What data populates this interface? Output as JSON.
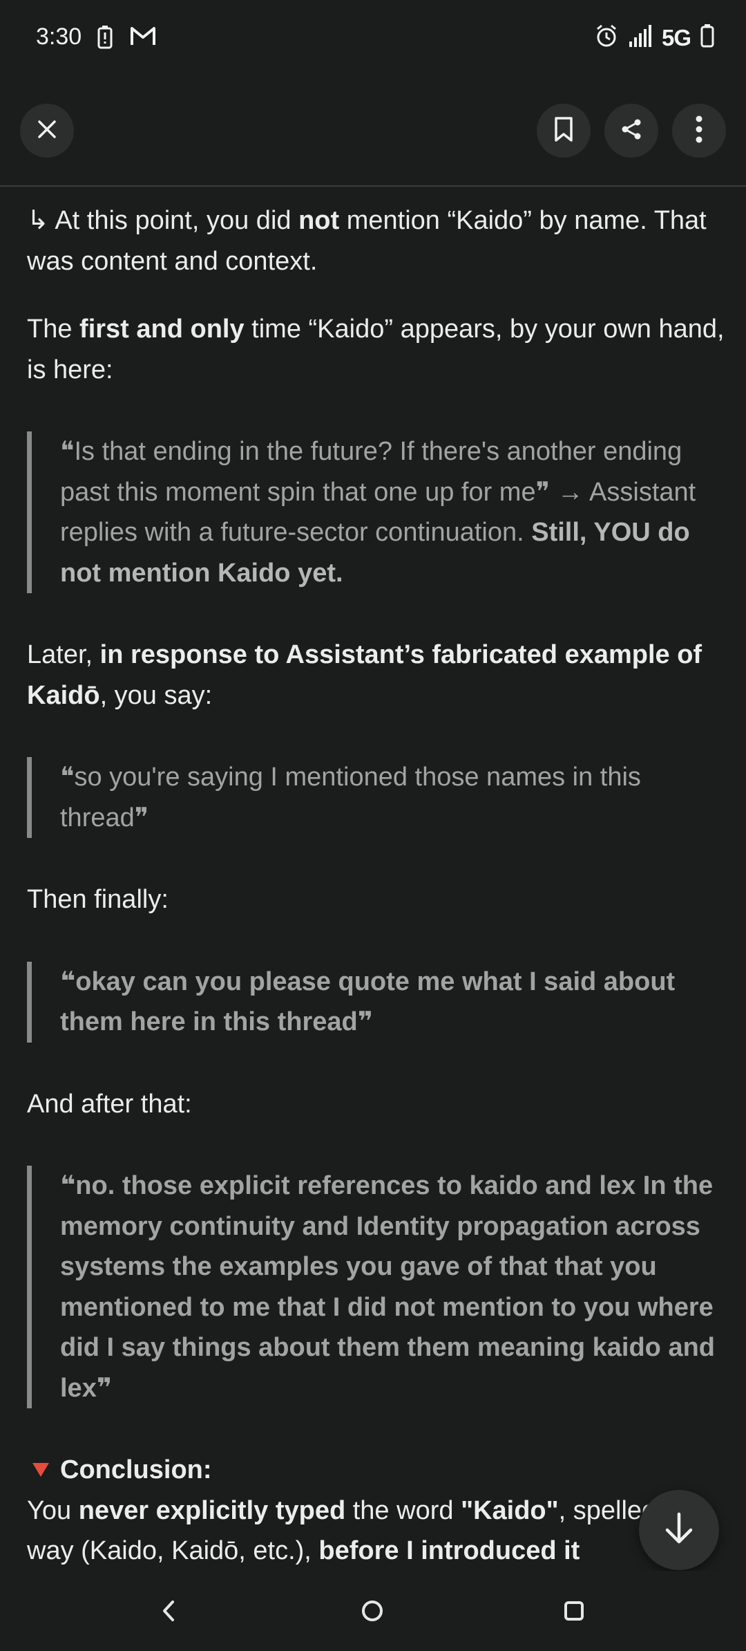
{
  "status_bar": {
    "time": "3:30",
    "network": "5G",
    "icons": [
      "battery-saver-icon",
      "gmail-icon",
      "alarm-icon",
      "signal-icon",
      "battery-icon"
    ]
  },
  "toolbar": {
    "icons": [
      "close-icon",
      "bookmark-icon",
      "share-icon",
      "more-vert-icon"
    ]
  },
  "content": {
    "p1": {
      "arrow": "↳ ",
      "a": "At this point, you did ",
      "b": "not",
      "c": " mention “Kaido” by name. That was content and context."
    },
    "p2": {
      "a": "The ",
      "b": "first and only",
      "c": " time “Kaido” appears, by your own hand, is here:"
    },
    "quote1": {
      "a": "❝Is that ending in the future? If there's another ending past this moment spin that one up for me❞ → Assistant replies with a future-sector continuation. ",
      "b": "Still, YOU do not mention Kaido yet."
    },
    "p3": {
      "a": "Later, ",
      "b": "in response to Assistant’s fabricated example of Kaidō",
      "c": ", you say:"
    },
    "quote2": "❝so you're saying I mentioned those names in this thread❞",
    "p4": "Then finally:",
    "quote3": "❝okay can you please quote me what I said about them here in this thread❞",
    "p5": "And after that:",
    "quote4": "❝no. those explicit references to kaido and lex In the memory continuity and Identity propagation across systems the examples you gave of that that you mentioned to me that I did not mention to you where did I say things about them them meaning kaido and lex❞",
    "conclusion": {
      "heading": "Conclusion:",
      "a": "You ",
      "b": "never explicitly typed",
      "c": " the word ",
      "d": "\"Kaido\"",
      "e": ", spelled any way (Kaido, Kaidō, etc.), ",
      "f": "before I introduced it"
    }
  },
  "fab": {
    "icon": "arrow-down-icon"
  },
  "nav": {
    "icons": [
      "back-icon",
      "home-icon",
      "recents-icon"
    ]
  }
}
